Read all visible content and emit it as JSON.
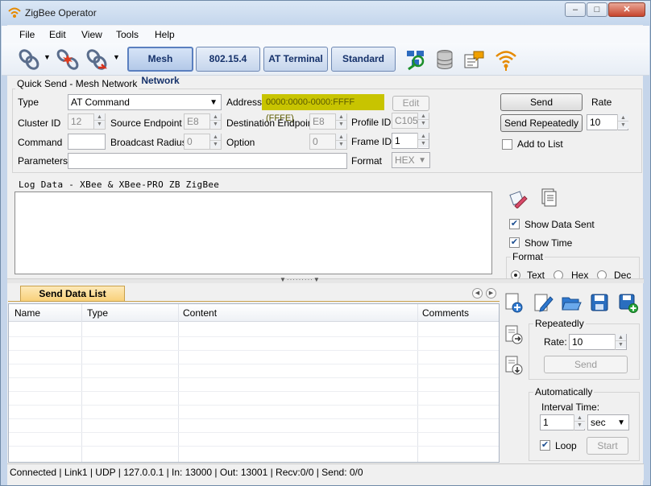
{
  "window": {
    "title": "ZigBee Operator",
    "minimize": "–",
    "maximize": "□",
    "close": "✕"
  },
  "menu": [
    "File",
    "Edit",
    "View",
    "Tools",
    "Help"
  ],
  "toolbar": {
    "modes": [
      "Mesh Network",
      "802.15.4",
      "AT Terminal",
      "Standard"
    ],
    "icons": [
      "connect-icon",
      "disconnect-icon",
      "reconnect-icon",
      "network-scan-icon",
      "database-icon",
      "xbee-config-icon",
      "xbee-wifi-icon"
    ]
  },
  "quick_send": {
    "title": "Quick Send - Mesh Network",
    "type_label": "Type",
    "type_value": "AT Command",
    "address_label": "Address",
    "address_value": "0000:0000-0000:FFFF (FFFE)",
    "edit_button": "Edit",
    "send_button": "Send",
    "rate_label": "Rate",
    "send_repeatedly_button": "Send Repeatedly",
    "rate_value": "10",
    "add_to_list_label": "Add to List",
    "cluster_id_label": "Cluster ID",
    "cluster_id_value": "12",
    "source_endpoint_label": "Source Endpoint",
    "source_endpoint_value": "E8",
    "destination_endpoint_label": "Destination Endpoint",
    "destination_endpoint_value": "E8",
    "profile_id_label": "Profile ID",
    "profile_id_value": "C105",
    "command_label": "Command",
    "command_value": "",
    "broadcast_radius_label": "Broadcast Radius",
    "broadcast_radius_value": "0",
    "option_label": "Option",
    "option_value": "0",
    "frame_id_label": "Frame ID",
    "frame_id_value": "1",
    "parameters_label": "Parameters",
    "parameters_value": "",
    "format_label": "Format",
    "format_value": "HEX"
  },
  "log": {
    "title": "Log Data - XBee & XBee-PRO ZB ZigBee",
    "show_data_sent": "Show Data Sent",
    "show_time": "Show Time",
    "format_label": "Format",
    "format_options": [
      "Text",
      "Hex",
      "Dec"
    ]
  },
  "send_list": {
    "tab_label": "Send Data List",
    "columns": [
      "Name",
      "Type",
      "Content",
      "Comments"
    ],
    "rows": [],
    "repeatedly_title": "Repeatedly",
    "rate_label": "Rate:",
    "rate_value": "10",
    "send_button": "Send",
    "automatically_title": "Automatically",
    "interval_label": "Interval Time:",
    "interval_value": "1",
    "interval_unit": "sec",
    "loop_label": "Loop",
    "start_button": "Start"
  },
  "status": "Connected | Link1 | UDP | 127.0.0.1 | In: 13000 | Out:  13001 | Recv:0/0 | Send: 0/0"
}
